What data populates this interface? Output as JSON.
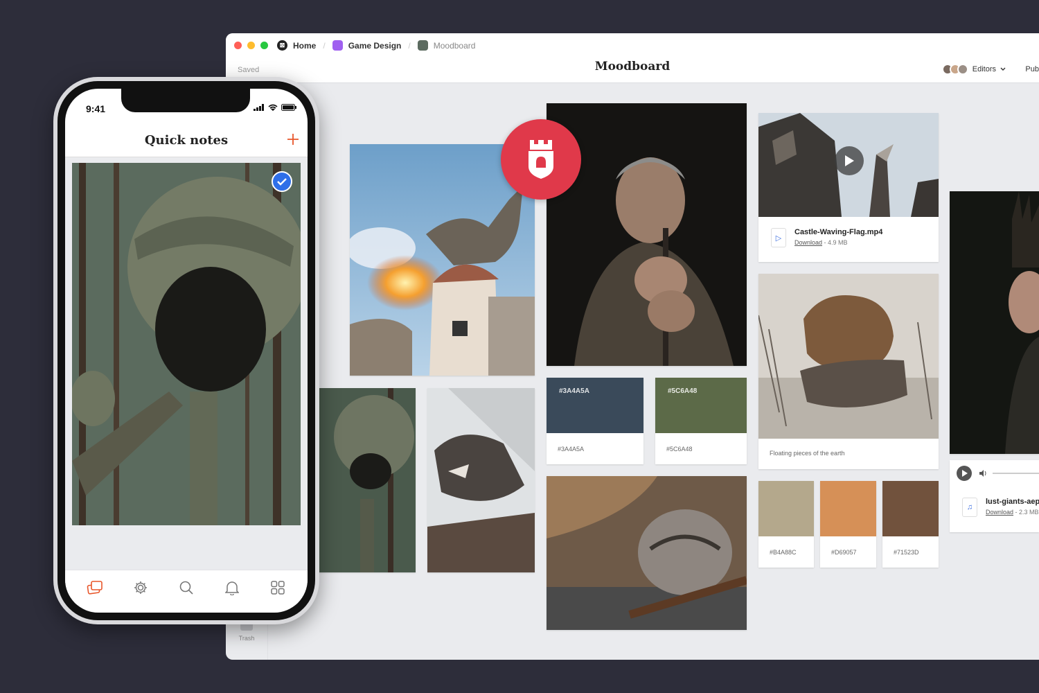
{
  "window": {
    "dot_colors": [
      "#ff5f57",
      "#febc2e",
      "#28c840"
    ],
    "breadcrumbs": [
      {
        "label": "Home",
        "icon": "home-logo-icon",
        "color": "#222222"
      },
      {
        "label": "Game Design",
        "icon": "board-icon",
        "color": "#a060f0"
      },
      {
        "label": "Moodboard",
        "icon": "board-icon",
        "color": "#5c6b60"
      }
    ],
    "saved_label": "Saved",
    "title": "Moodboard",
    "editors_label": "Editors",
    "publish_label": "Pub",
    "trash_label": "Trash"
  },
  "board": {
    "video": {
      "name": "Castle-Waving-Flag.mp4",
      "download": "Download",
      "size": "- 4.9 MB"
    },
    "rock_caption": "Floating pieces of the earth",
    "audio": {
      "name": "lust-giants-aep",
      "download": "Download",
      "size": "- 2.3 MB"
    },
    "swatches_top": [
      {
        "hex": "#3A4A5A",
        "label": "#3A4A5A"
      },
      {
        "hex": "#5C6A48",
        "label": "#5C6A48"
      }
    ],
    "swatches_bottom": [
      {
        "hex": "#B4A88C",
        "label": "#B4A88C"
      },
      {
        "hex": "#D69057",
        "label": "#D69057"
      },
      {
        "hex": "#71523D",
        "label": "#71523D"
      }
    ],
    "badge_color": "#e0394a"
  },
  "phone": {
    "time": "9:41",
    "title": "Quick notes",
    "accent": "#e8562a",
    "tabs": [
      "cards-icon",
      "gear-icon",
      "search-icon",
      "bell-icon",
      "grid-icon"
    ]
  }
}
